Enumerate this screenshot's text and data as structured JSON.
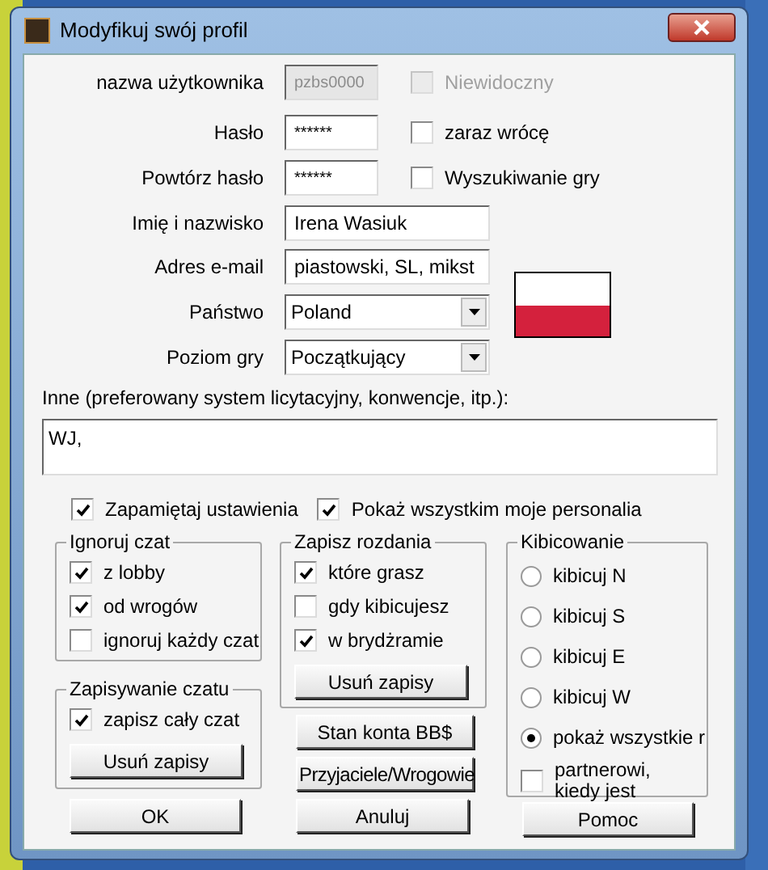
{
  "window": {
    "title": "Modyfikuj swój  profil"
  },
  "fields": [
    {
      "label": "nazwa użytkownika",
      "value": "pzbs0000",
      "disabled": true,
      "kind": "text"
    },
    {
      "label": "Hasło",
      "value": "******",
      "kind": "text"
    },
    {
      "label": "Powtórz hasło",
      "value": "******",
      "kind": "text"
    },
    {
      "label": "Imię i nazwisko",
      "value": "Irena Wasiuk",
      "kind": "wide"
    },
    {
      "label": "Adres e-mail",
      "value": "piastowski, SL, mikst",
      "kind": "wide"
    },
    {
      "label": "Państwo",
      "value": "Poland",
      "kind": "combo"
    },
    {
      "label": "Poziom gry",
      "value": "Początkujący",
      "kind": "combo"
    }
  ],
  "side_checks": [
    {
      "label": "Niewidoczny",
      "checked": false,
      "disabled": true
    },
    {
      "label": "zaraz wrócę",
      "checked": false,
      "disabled": false
    },
    {
      "label": "Wyszukiwanie gry",
      "checked": false,
      "disabled": false
    }
  ],
  "other": {
    "label": "Inne (preferowany system licytacyjny, konwencje, itp.):",
    "value": "WJ,"
  },
  "options": [
    {
      "label": "Zapamiętaj ustawienia",
      "checked": true
    },
    {
      "label": "Pokaż wszystkim moje personalia",
      "checked": true
    }
  ],
  "ignore_chat": {
    "title": "Ignoruj czat",
    "items": [
      {
        "label": "z lobby",
        "checked": true
      },
      {
        "label": "od wrogów",
        "checked": true
      },
      {
        "label": "ignoruj każdy czat",
        "checked": false
      }
    ]
  },
  "save_chat": {
    "title": "Zapisywanie czatu",
    "items": [
      {
        "label": "zapisz cały czat",
        "checked": true
      }
    ],
    "button": "Usuń zapisy"
  },
  "save_deals": {
    "title": "Zapisz rozdania",
    "items": [
      {
        "label": "które grasz",
        "checked": true
      },
      {
        "label": "gdy kibicujesz",
        "checked": false
      },
      {
        "label": "w brydżramie",
        "checked": true
      }
    ],
    "button": "Usuń zapisy"
  },
  "middle_buttons": [
    "Stan konta BB$",
    "Przyjaciele/Wrogowie"
  ],
  "kibicowanie": {
    "title": "Kibicowanie",
    "items": [
      {
        "kind": "radio",
        "label": "kibicuj N",
        "selected": false
      },
      {
        "kind": "radio",
        "label": "kibicuj S",
        "selected": false
      },
      {
        "kind": "radio",
        "label": "kibicuj E",
        "selected": false
      },
      {
        "kind": "radio",
        "label": "kibicuj W",
        "selected": false
      },
      {
        "kind": "radio",
        "label": "pokaż wszystkie r",
        "selected": true
      },
      {
        "kind": "checkbox",
        "label": "partnerowi, kiedy jest",
        "checked": false
      }
    ]
  },
  "buttons": [
    "OK",
    "Anuluj",
    "Pomoc"
  ]
}
